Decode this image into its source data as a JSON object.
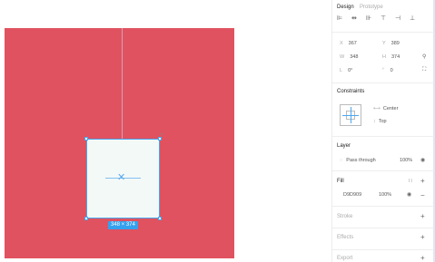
{
  "panel": {
    "tabs": [
      "Design",
      "Prototype"
    ],
    "align_icons": [
      "align-left-icon",
      "align-center-h-icon",
      "align-right-icon",
      "align-top-icon",
      "align-center-v-icon",
      "align-bottom-icon"
    ],
    "position": {
      "x_label": "X",
      "x": "367",
      "y_label": "Y",
      "y": "389"
    },
    "size": {
      "w_label": "W",
      "w": "348",
      "h_label": "H",
      "h": "374"
    },
    "rotation": {
      "r_label": "L",
      "r": "0°",
      "c_label": "",
      "c": "0"
    },
    "constraints": {
      "title": "Constraints",
      "horizontal": "Center",
      "vertical": "Top"
    },
    "layer": {
      "title": "Layer",
      "blend": "Pass through",
      "opacity": "100%"
    },
    "fill": {
      "title": "Fill",
      "hex": "D9D909",
      "opacity": "100%"
    },
    "sections": {
      "stroke": "Stroke",
      "effects": "Effects",
      "export": "Export"
    }
  },
  "canvas": {
    "size_badge": "348 × 374",
    "artboard_color": "#e0525f",
    "frame_color": "#f3f9f7",
    "selection_color": "#4aa7f0"
  }
}
